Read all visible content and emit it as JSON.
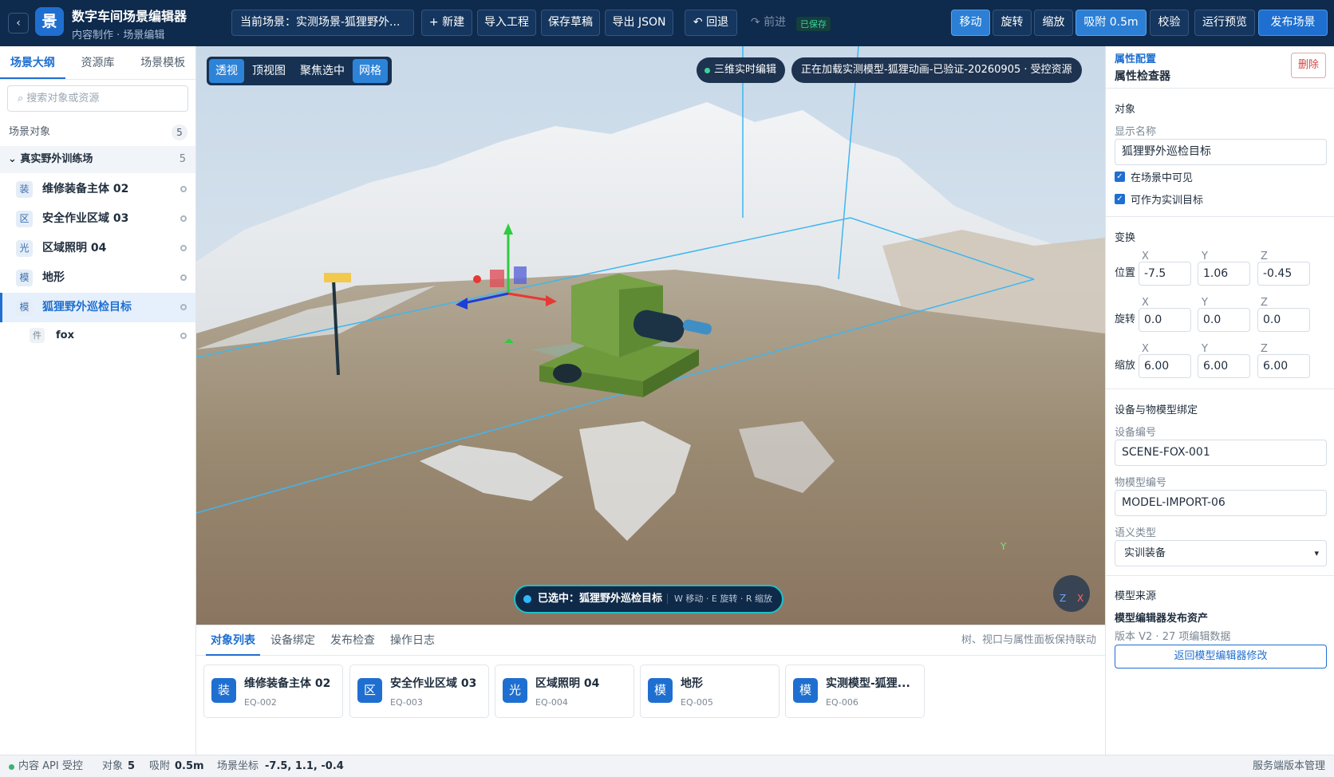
{
  "app": {
    "logo": "景",
    "title": "数字车间场景编辑器",
    "subtitle": "内容制作 · 场景编辑"
  },
  "toolbar": {
    "back_icon": "‹",
    "scene_label": "当前场景：实测场景-狐狸野外...",
    "new_label": "+ 新建",
    "import_label": "导入工程",
    "save_draft_label": "保存草稿",
    "export_label": "导出 JSON",
    "undo_label": "↶ 回退",
    "redo_label": "↷ 前进",
    "saved_label": "已保存",
    "move_label": "移动",
    "rotate_label": "旋转",
    "scale_label": "缩放",
    "snap_label": "吸附 0.5m",
    "validate_label": "校验",
    "preview_label": "运行预览",
    "publish_label": "发布场景"
  },
  "sidebar": {
    "tabs": [
      "场景大纲",
      "资源库",
      "场景模板"
    ],
    "active_tab": "场景大纲",
    "search_placeholder": "⌕ 搜索对象或资源",
    "section_title": "场景对象",
    "section_count": "5",
    "group_label": "⌄ 真实野外训练场",
    "group_count": "5",
    "items": [
      {
        "icon": "装",
        "label": "维修装备主体 02"
      },
      {
        "icon": "区",
        "label": "安全作业区域 03"
      },
      {
        "icon": "光",
        "label": "区域照明 04"
      },
      {
        "icon": "模",
        "label": "地形"
      },
      {
        "icon": "模",
        "label": "狐狸野外巡检目标",
        "selected": true
      }
    ],
    "child": {
      "icon": "件",
      "label": "fox"
    }
  },
  "viewport": {
    "toggles": [
      "透视",
      "顶视图",
      "聚焦选中",
      "网格"
    ],
    "live_label": "三维实时编辑",
    "loading_label": "正在加载实测模型-狐狸动画-已验证-20260905 · 受控资源",
    "selected_prefix": "已选中：",
    "selected_name": "狐狸野外巡检目标",
    "selected_hint": "W 移动 · E 旋转 · R 缩放",
    "axes": {
      "x": "X",
      "y": "Y",
      "z": "Z"
    },
    "colors": {
      "x_axis": "#e53935",
      "y_axis": "#2ecc40",
      "z_axis": "#1e3fd6",
      "bounds": "#3fb6f0",
      "model": "#6e9a3c"
    }
  },
  "bottom_panel": {
    "tabs": [
      "对象列表",
      "设备绑定",
      "发布检查",
      "操作日志"
    ],
    "active_tab": "对象列表",
    "note": "树、视口与属性面板保持联动",
    "cards": [
      {
        "icon": "装",
        "name": "维修装备主体 02",
        "code": "EQ-002"
      },
      {
        "icon": "区",
        "name": "安全作业区域 03",
        "code": "EQ-003"
      },
      {
        "icon": "光",
        "name": "区域照明 04",
        "code": "EQ-004"
      },
      {
        "icon": "模",
        "name": "地形",
        "code": "EQ-005"
      },
      {
        "icon": "模",
        "name": "实测模型-狐狸...",
        "code": "EQ-006"
      }
    ]
  },
  "inspector": {
    "caption": "属性配置",
    "title": "属性检查器",
    "delete_label": "删除",
    "object_section": "对象",
    "display_name_label": "显示名称",
    "display_name_value": "狐狸野外巡检目标",
    "visible_label": "在场景中可见",
    "target_label": "可作为实训目标",
    "transform_section": "变换",
    "axes": [
      "X",
      "Y",
      "Z"
    ],
    "position_label": "位置",
    "position": [
      "-7.5",
      "1.06",
      "-0.45"
    ],
    "rotation_label": "旋转",
    "rotation": [
      "0.0",
      "0.0",
      "0.0"
    ],
    "scale_label": "缩放",
    "scale": [
      "6.00",
      "6.00",
      "6.00"
    ],
    "binding_section": "设备与物模型绑定",
    "device_id_label": "设备编号",
    "device_id_value": "SCENE-FOX-001",
    "model_id_label": "物模型编号",
    "model_id_value": "MODEL-IMPORT-06",
    "semantic_label": "语义类型",
    "semantic_value": "实训装备",
    "source_section": "模型来源",
    "source_title": "模型编辑器发布资产",
    "source_meta": "版本 V2 · 27 项编辑数据",
    "back_editor_label": "返回模型编辑器修改"
  },
  "statusbar": {
    "api_label": "内容 API 受控",
    "objects_label": "对象",
    "objects_count": "5",
    "snap_label": "吸附",
    "snap_value": "0.5m",
    "coords_label": "场景坐标",
    "coords_value": "-7.5, 1.1, -0.4",
    "right_label": "服务端版本管理"
  }
}
